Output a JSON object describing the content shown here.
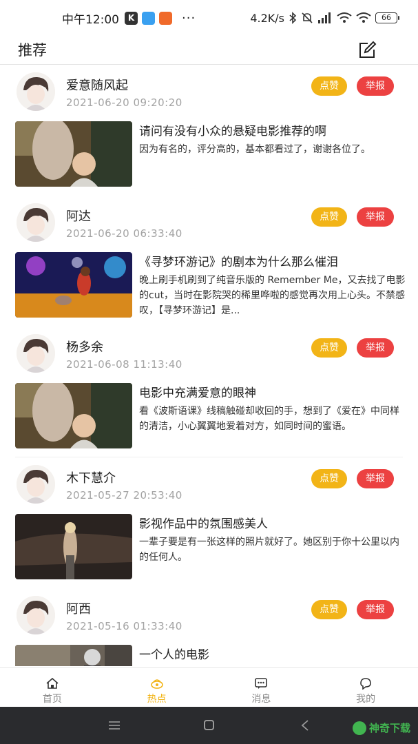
{
  "status_bar": {
    "time": "中午12:00",
    "k_badge": "K",
    "dots": "···",
    "net_speed": "4.2K/s",
    "battery": "66",
    "icons": [
      "k-app-icon",
      "blue-app-icon",
      "orange-app-icon",
      "bluetooth-icon",
      "mute-icon",
      "signal-icon",
      "wifi-icon",
      "battery-icon"
    ]
  },
  "header": {
    "title": "推荐",
    "compose_icon": "edit-icon"
  },
  "buttons": {
    "like": "点赞",
    "report": "举报"
  },
  "posts": [
    {
      "username": "爱意随风起",
      "time": "2021-06-20  09:20:20",
      "title": "请问有没有小众的悬疑电影推荐的啊",
      "excerpt": "因为有名的，评分高的，基本都看过了，谢谢各位了。",
      "thumb": "family-dinner-still"
    },
    {
      "username": "阿达",
      "time": "2021-06-20  06:33:40",
      "title": "《寻梦环游记》的剧本为什么那么催泪",
      "excerpt": "晚上刷手机刷到了纯音乐版的 Remember Me，又去找了电影的cut，当时在影院哭的稀里哗啦的感觉再次用上心头。不禁感叹，【寻梦环游记】是...",
      "thumb": "coco-guitar-still"
    },
    {
      "username": "杨多余",
      "time": "2021-06-08  11:13:40",
      "title": "电影中充满爱意的眼神",
      "excerpt": "看《波斯语课》线稿触碰却收回的手，想到了《爱在》中同样的清洁，小心翼翼地爱着对方，如同时间的蜜语。",
      "thumb": "family-dinner-still"
    },
    {
      "username": "木下慧介",
      "time": "2021-05-27  20:53:40",
      "title": "影视作品中的氛围感美人",
      "excerpt": "一辈子要是有一张这样的照片就好了。她区别于你十公里以内的任何人。",
      "thumb": "night-car-still"
    },
    {
      "username": "阿西",
      "time": "2021-05-16  01:33:40",
      "title": "一个人的电影",
      "excerpt": "",
      "thumb": "street-still"
    }
  ],
  "bottom_nav": [
    {
      "label": "首页",
      "icon": "home-icon",
      "active": false
    },
    {
      "label": "热点",
      "icon": "hot-icon",
      "active": true
    },
    {
      "label": "消息",
      "icon": "message-icon",
      "active": false
    },
    {
      "label": "我的",
      "icon": "profile-icon",
      "active": false
    }
  ],
  "watermark": "神奇下载",
  "colors": {
    "like": "#f2b417",
    "report": "#ec4141",
    "active_tab": "#f2b417",
    "watermark": "#41b550"
  }
}
